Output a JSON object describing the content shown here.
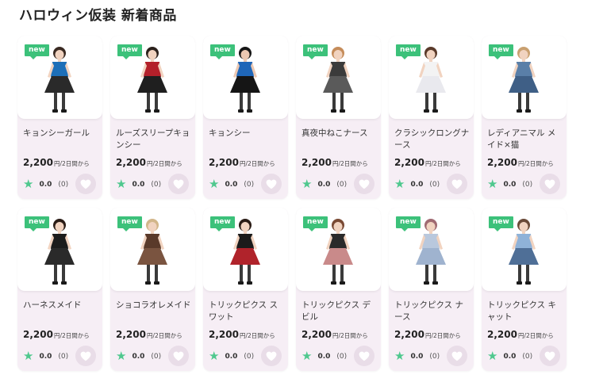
{
  "header": {
    "title": "ハロウィン仮装 新着商品"
  },
  "theme": {
    "accent_new": "#3cc17a",
    "star_color": "#4fc88e",
    "card_bg": "#f6eef5",
    "fav_bg": "#e9dde8"
  },
  "products": [
    {
      "badge": "new",
      "name": "キョンシーガール",
      "price": "2,200",
      "price_unit": "円/2日間から",
      "rating": "0.0",
      "reviews": "(0)",
      "icon": "heart-icon",
      "colors": {
        "top": "#1d6fb8",
        "dress": "#2a2a2a",
        "skin": "#f1d3c0",
        "hair": "#3a2a22"
      }
    },
    {
      "badge": "new",
      "name": "ルーズスリープキョンシー",
      "price": "2,200",
      "price_unit": "円/2日間から",
      "rating": "0.0",
      "reviews": "(0)",
      "icon": "heart-icon",
      "colors": {
        "top": "#b3202a",
        "dress": "#1f1f1f",
        "skin": "#f1d3c0",
        "hair": "#2b211c"
      }
    },
    {
      "badge": "new",
      "name": "キョンシー",
      "price": "2,200",
      "price_unit": "円/2日間から",
      "rating": "0.0",
      "reviews": "(0)",
      "icon": "heart-icon",
      "colors": {
        "top": "#1f66b8",
        "dress": "#151515",
        "skin": "#ecc8b2",
        "hair": "#161616"
      }
    },
    {
      "badge": "new",
      "name": "真夜中ねこナース",
      "price": "2,200",
      "price_unit": "円/2日間から",
      "rating": "0.0",
      "reviews": "(0)",
      "icon": "heart-icon",
      "colors": {
        "top": "#3b3b3b",
        "dress": "#5a5a5a",
        "skin": "#f1d3c0",
        "hair": "#c58c5a"
      }
    },
    {
      "badge": "new",
      "name": "クラシックロングナース",
      "price": "2,200",
      "price_unit": "円/2日間から",
      "rating": "0.0",
      "reviews": "(0)",
      "icon": "heart-icon",
      "colors": {
        "top": "#f3f3f3",
        "dress": "#e9e9ee",
        "skin": "#f1d3c0",
        "hair": "#5a3a2a"
      }
    },
    {
      "badge": "new",
      "name": "レディアニマル メイド×猫",
      "price": "2,200",
      "price_unit": "円/2日間から",
      "rating": "0.0",
      "reviews": "(0)",
      "icon": "heart-icon",
      "colors": {
        "top": "#5a7fa8",
        "dress": "#3f5f86",
        "skin": "#f1d3c0",
        "hair": "#c9a070"
      }
    },
    {
      "badge": "new",
      "name": "ハーネスメイド",
      "price": "2,200",
      "price_unit": "円/2日間から",
      "rating": "0.0",
      "reviews": "(0)",
      "icon": "heart-icon",
      "colors": {
        "top": "#1c1c1c",
        "dress": "#2a2a2a",
        "skin": "#f1d3c0",
        "hair": "#2a1c16"
      }
    },
    {
      "badge": "new",
      "name": "ショコラオレメイド",
      "price": "2,200",
      "price_unit": "円/2日間から",
      "rating": "0.0",
      "reviews": "(0)",
      "icon": "heart-icon",
      "colors": {
        "top": "#5a3a2a",
        "dress": "#7a5440",
        "skin": "#f1d3c0",
        "hair": "#d2b68a"
      }
    },
    {
      "badge": "new",
      "name": "トリックピクス スワット",
      "price": "2,200",
      "price_unit": "円/2日間から",
      "rating": "0.0",
      "reviews": "(0)",
      "icon": "heart-icon",
      "colors": {
        "top": "#1b1b1b",
        "dress": "#b0232b",
        "skin": "#f1d3c0",
        "hair": "#2a1c16"
      }
    },
    {
      "badge": "new",
      "name": "トリックピクス デビル",
      "price": "2,200",
      "price_unit": "円/2日間から",
      "rating": "0.0",
      "reviews": "(0)",
      "icon": "heart-icon",
      "colors": {
        "top": "#2a2a2a",
        "dress": "#c98a8a",
        "skin": "#f1d3c0",
        "hair": "#7a4a34"
      }
    },
    {
      "badge": "new",
      "name": "トリックピクス ナース",
      "price": "2,200",
      "price_unit": "円/2日間から",
      "rating": "0.0",
      "reviews": "(0)",
      "icon": "heart-icon",
      "colors": {
        "top": "#b9c8dd",
        "dress": "#9fb3cf",
        "skin": "#f1d3c0",
        "hair": "#a06a72"
      }
    },
    {
      "badge": "new",
      "name": "トリックピクス キャット",
      "price": "2,200",
      "price_unit": "円/2日間から",
      "rating": "0.0",
      "reviews": "(0)",
      "icon": "heart-icon",
      "colors": {
        "top": "#8fb2d8",
        "dress": "#4f6f97",
        "skin": "#f1d3c0",
        "hair": "#6a4a38"
      }
    }
  ]
}
